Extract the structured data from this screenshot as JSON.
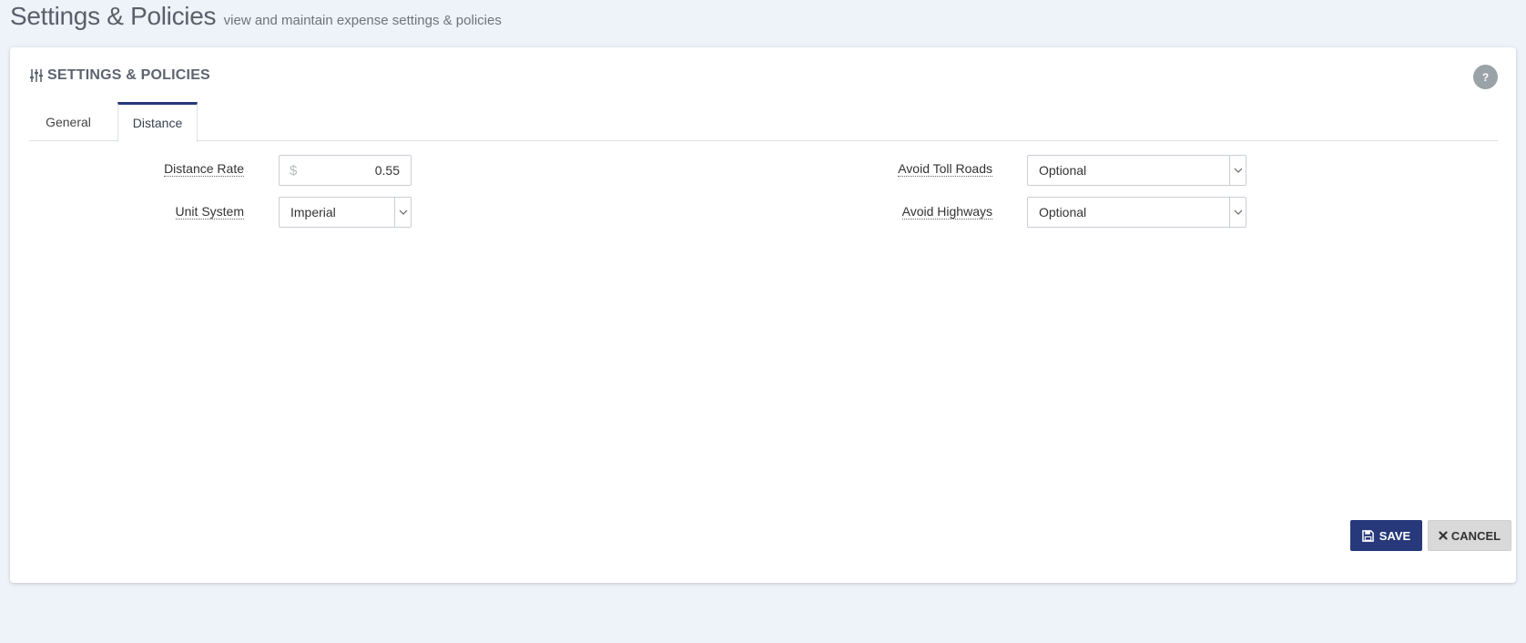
{
  "header": {
    "title": "Settings & Policies",
    "subtitle": "view and maintain expense settings & policies"
  },
  "portlet": {
    "title": "SETTINGS & POLICIES",
    "help_label": "?"
  },
  "tabs": [
    {
      "label": "General",
      "active": false
    },
    {
      "label": "Distance",
      "active": true
    }
  ],
  "form": {
    "distance_rate": {
      "label": "Distance Rate",
      "currency": "$",
      "value": "0.55"
    },
    "unit_system": {
      "label": "Unit System",
      "value": "Imperial"
    },
    "avoid_toll_roads": {
      "label": "Avoid Toll Roads",
      "value": "Optional"
    },
    "avoid_highways": {
      "label": "Avoid Highways",
      "value": "Optional"
    }
  },
  "actions": {
    "save_label": "SAVE",
    "cancel_label": "CANCEL"
  },
  "colors": {
    "accent": "#27397a",
    "background": "#eef2f9"
  }
}
